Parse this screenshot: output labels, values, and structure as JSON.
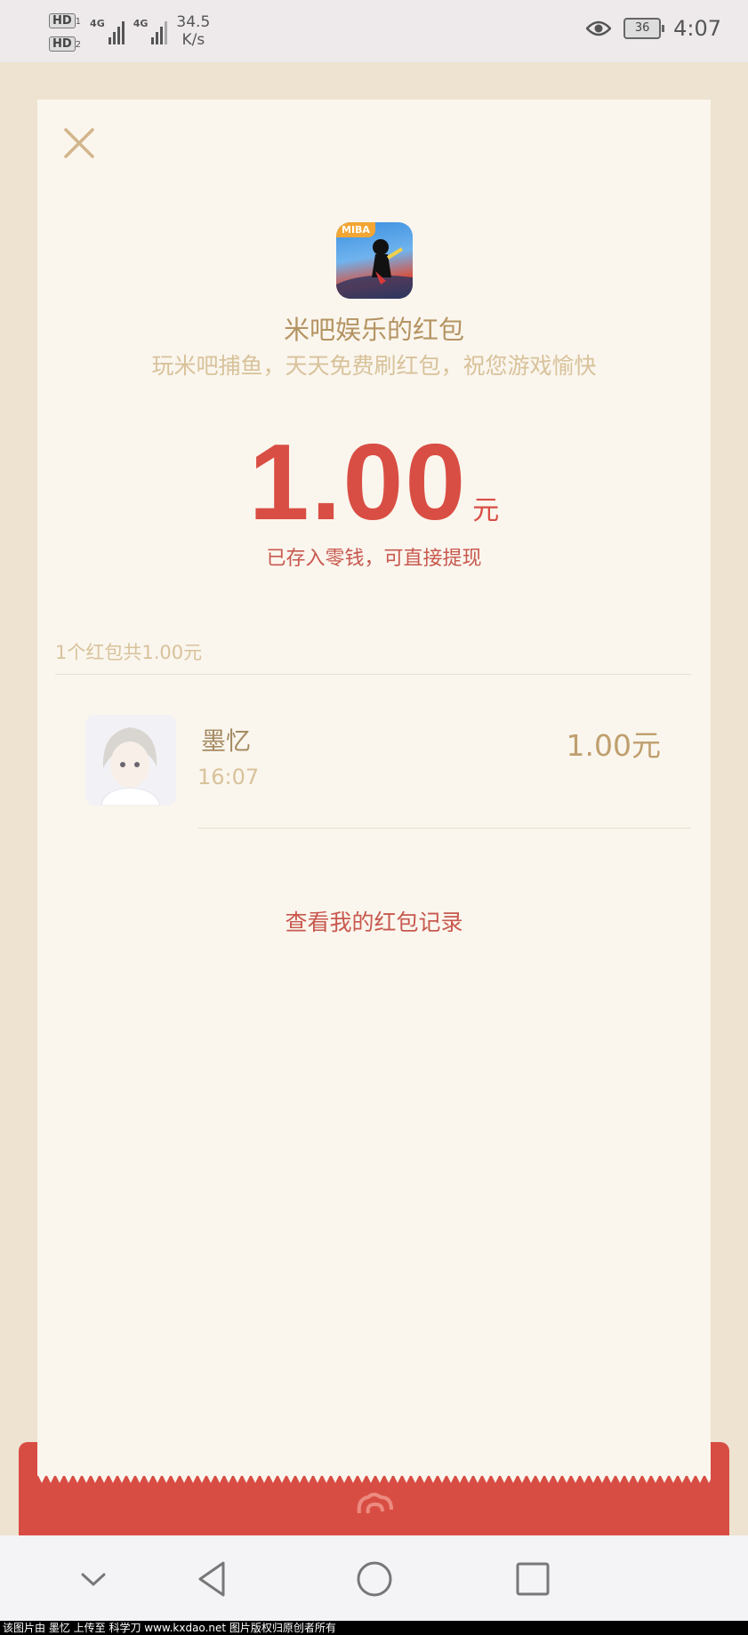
{
  "status_bar": {
    "hd1": "HD",
    "sim1": "1",
    "hd2": "HD",
    "sim2": "2",
    "net1": "4G",
    "net2": "4G",
    "speed_value": "34.5",
    "speed_unit": "K/s",
    "battery": "36",
    "time": "4:07",
    "icons": [
      "eye-icon",
      "battery-icon"
    ]
  },
  "card": {
    "app_badge": "MIBA",
    "title": "米吧娱乐的红包",
    "subtitle": "玩米吧捕鱼，天天免费刷红包，祝您游戏愉快",
    "amount": "1.00",
    "amount_unit": "元",
    "saved_note": "已存入零钱，可直接提现",
    "summary": "1个红包共1.00元",
    "record": {
      "name": "墨忆",
      "time": "16:07",
      "amount": "1.00元"
    },
    "view_records": "查看我的红包记录"
  },
  "colors": {
    "accent_red": "#d94e44",
    "gold": "#b59463",
    "card_bg": "#faf6ee"
  },
  "nav_bar": {
    "icons": [
      "chevron-down-icon",
      "back-triangle-icon",
      "home-circle-icon",
      "recents-square-icon"
    ]
  },
  "footer": "该图片由 墨忆 上传至 科学刀 www.kxdao.net 图片版权归原创者所有"
}
